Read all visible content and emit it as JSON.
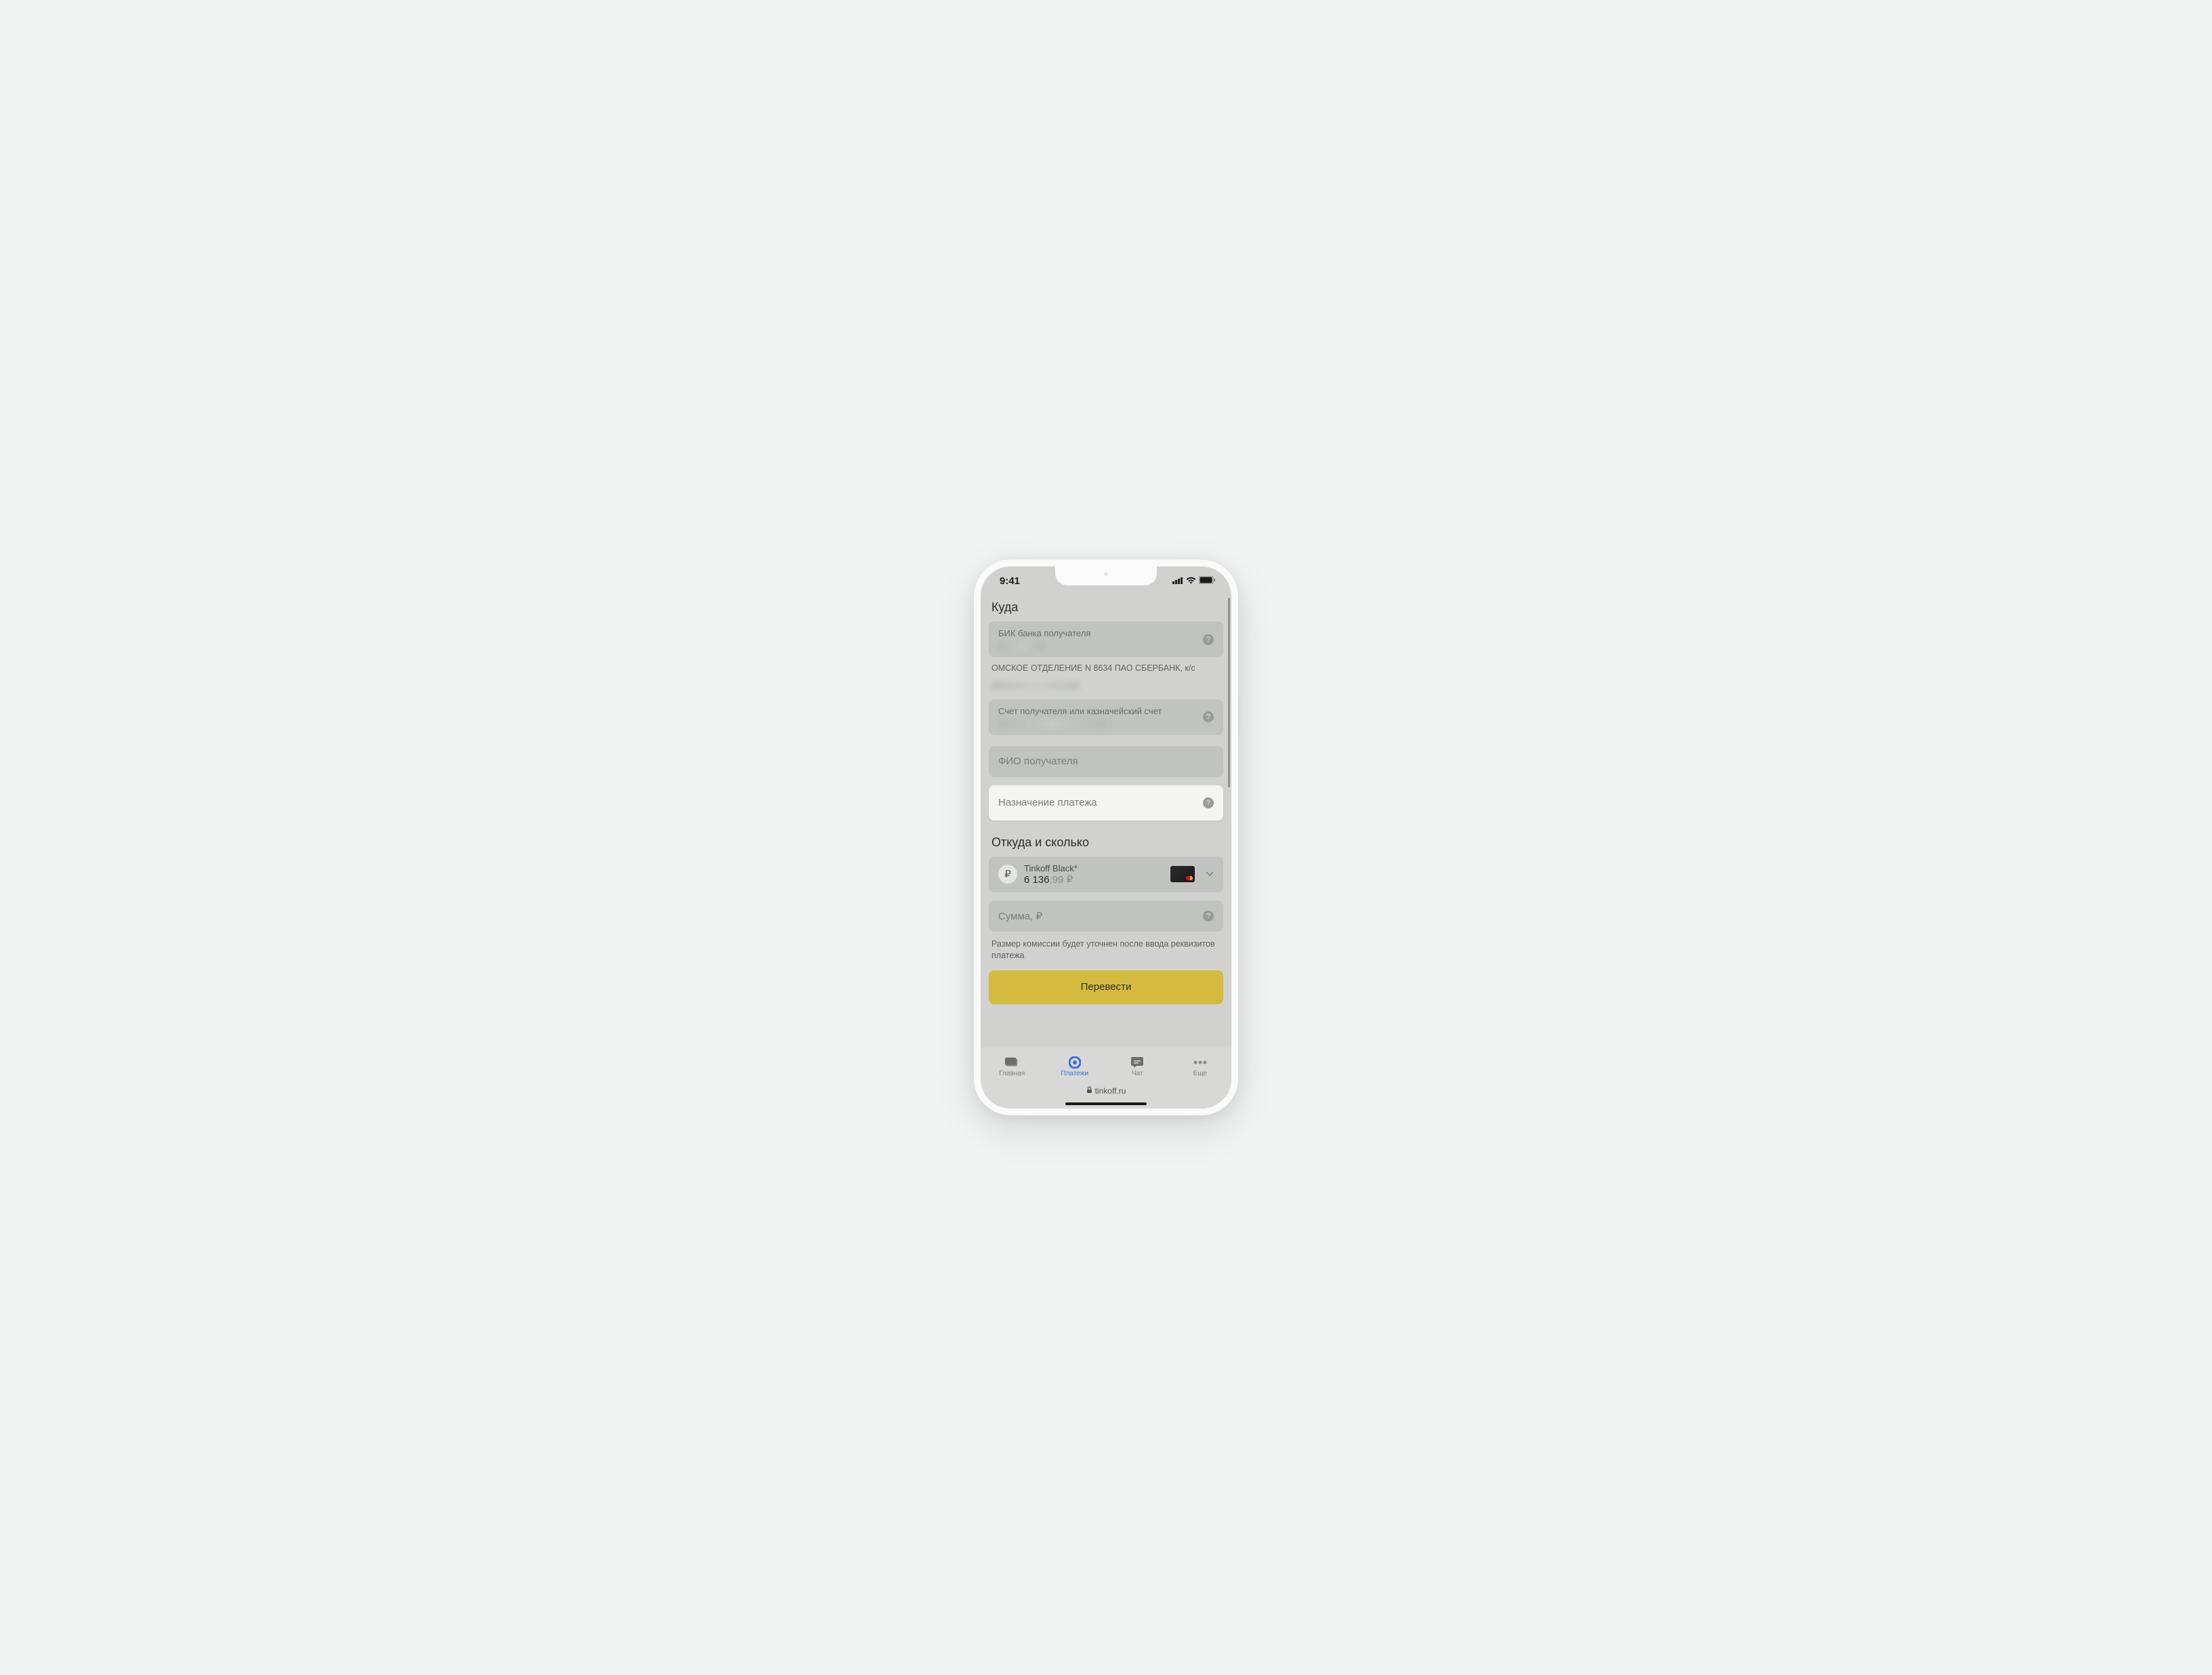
{
  "status": {
    "time": "9:41"
  },
  "sections": {
    "destination_title": "Куда",
    "source_title": "Откуда и сколько"
  },
  "fields": {
    "bik_label": "БИК банка получателя",
    "bank_info": "ОМСКОЕ ОТДЕЛЕНИЕ N 8634 ПАО СБЕРБАНК, к/с",
    "account_label": "Счет получателя или казначейский счет",
    "fio_label": "ФИО получателя",
    "purpose_label": "Назначение платежа",
    "amount_label": "Сумма, ₽"
  },
  "source_account": {
    "name": "Tinkoff Black*",
    "balance_main": "6 136",
    "balance_cents": ",99 ₽"
  },
  "commission_hint": "Размер комиссии будет уточнен после ввода реквизитов платежа",
  "primary_action": "Перевести",
  "tabs": {
    "home": "Главная",
    "payments": "Платежи",
    "chat": "Чат",
    "more": "Еще"
  },
  "url": "tinkoff.ru"
}
